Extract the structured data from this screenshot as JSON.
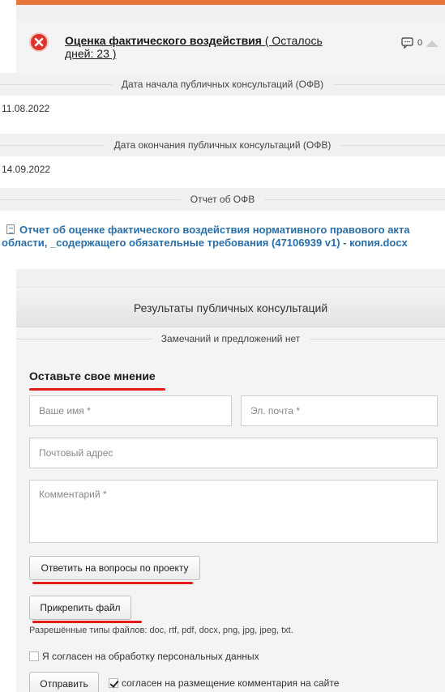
{
  "stage": {
    "title": "Оценка фактического воздействия",
    "remaining": " ( Осталось дней: 23 )",
    "comments_count": "0"
  },
  "sections": {
    "start_label": "Дата начала публичных консультаций (ОФВ)",
    "start_value": "11.08.2022",
    "end_label": "Дата окончания публичных консультаций (ОФВ)",
    "end_value": "14.09.2022",
    "report_label": "Отчет об ОФВ",
    "report_link": "Отчет об оценке фактического воздействия нормативного правового акта области, _содержащего обязательные требования (47106939 v1) - копия.docx"
  },
  "results": {
    "title": "Результаты публичных консультаций",
    "no_comments": "Замечаний и предложений нет"
  },
  "form": {
    "heading": "Оставьте свое мнение",
    "name_placeholder": "Ваше имя *",
    "email_placeholder": "Эл. почта *",
    "address_placeholder": "Почтовый адрес",
    "comment_placeholder": "Комментарий *",
    "answer_button": "Ответить на вопросы по проекту",
    "attach_button": "Прикрепить файл",
    "file_types_hint": "Разрешённые типы файлов: doc, rtf, pdf, docx, png, jpg, jpeg, txt.",
    "consent_personal": "Я согласен на обработку персональных данных",
    "consent_personal_checked": false,
    "submit_button": "Отправить",
    "consent_publish": "согласен на размещение комментария на сайте",
    "consent_publish_checked": true
  },
  "colors": {
    "accent_top": "#e8763a",
    "status_icon": "#e0352b",
    "link": "#2a6fa8",
    "annotation_red": "#e31b1b"
  }
}
